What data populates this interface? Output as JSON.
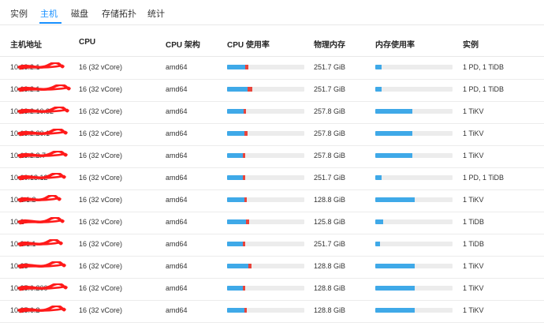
{
  "tabs": [
    {
      "label": "实例",
      "active": false
    },
    {
      "label": "主机",
      "active": true
    },
    {
      "label": "磁盘",
      "active": false
    },
    {
      "label": "存储拓扑",
      "active": false
    },
    {
      "label": "统计",
      "active": false
    }
  ],
  "columns": [
    "主机地址",
    "CPU",
    "CPU 架构",
    "CPU 使用率",
    "物理内存",
    "内存使用率",
    "实例"
  ],
  "colors": {
    "accent": "#1890ff",
    "cpu_user": "#3fa9e8",
    "cpu_sys": "#e8453c",
    "mem_used": "#3fa9e8",
    "redaction": "#ff1a1a",
    "track": "#ececec"
  },
  "rows": [
    {
      "host": "10.13.2.1",
      "cpu": "16 (32 vCore)",
      "arch": "amd64",
      "cpu_user": 0.23,
      "cpu_sys": 0.04,
      "memory": "251.7 GiB",
      "mem_usage": 0.08,
      "instances": "1 PD, 1 TiDB"
    },
    {
      "host": "10.13.2.1",
      "cpu": "16 (32 vCore)",
      "arch": "amd64",
      "cpu_user": 0.27,
      "cpu_sys": 0.06,
      "memory": "251.7 GiB",
      "mem_usage": 0.08,
      "instances": "1 PD, 1 TiDB"
    },
    {
      "host": "10.13.2.10.32",
      "cpu": "16 (32 vCore)",
      "arch": "amd64",
      "cpu_user": 0.21,
      "cpu_sys": 0.03,
      "memory": "257.8 GiB",
      "mem_usage": 0.48,
      "instances": "1 TiKV"
    },
    {
      "host": "10.13.2.20.1",
      "cpu": "16 (32 vCore)",
      "arch": "amd64",
      "cpu_user": 0.22,
      "cpu_sys": 0.04,
      "memory": "257.8 GiB",
      "mem_usage": 0.48,
      "instances": "1 TiKV"
    },
    {
      "host": "10.13.2.2.7",
      "cpu": "16 (32 vCore)",
      "arch": "amd64",
      "cpu_user": 0.2,
      "cpu_sys": 0.03,
      "memory": "257.8 GiB",
      "mem_usage": 0.48,
      "instances": "1 TiKV"
    },
    {
      "host": "10.10.13.12",
      "cpu": "16 (32 vCore)",
      "arch": "amd64",
      "cpu_user": 0.2,
      "cpu_sys": 0.03,
      "memory": "251.7 GiB",
      "mem_usage": 0.08,
      "instances": "1 PD, 1 TiDB"
    },
    {
      "host": "10.1.1.2",
      "cpu": "16 (32 vCore)",
      "arch": "amd64",
      "cpu_user": 0.22,
      "cpu_sys": 0.03,
      "memory": "128.8 GiB",
      "mem_usage": 0.51,
      "instances": "1 TiKV"
    },
    {
      "host": "10.1",
      "cpu": "16 (32 vCore)",
      "arch": "amd64",
      "cpu_user": 0.24,
      "cpu_sys": 0.04,
      "memory": "125.8 GiB",
      "mem_usage": 0.1,
      "instances": "1 TiDB"
    },
    {
      "host": "10.2.1.1",
      "cpu": "16 (32 vCore)",
      "arch": "amd64",
      "cpu_user": 0.2,
      "cpu_sys": 0.03,
      "memory": "251.7 GiB",
      "mem_usage": 0.06,
      "instances": "1 TiDB"
    },
    {
      "host": "10.25",
      "cpu": "16 (32 vCore)",
      "arch": "amd64",
      "cpu_user": 0.28,
      "cpu_sys": 0.04,
      "memory": "128.8 GiB",
      "mem_usage": 0.51,
      "instances": "1 TiKV"
    },
    {
      "host": "10.25.0.200",
      "cpu": "16 (32 vCore)",
      "arch": "amd64",
      "cpu_user": 0.2,
      "cpu_sys": 0.03,
      "memory": "128.8 GiB",
      "mem_usage": 0.51,
      "instances": "1 TiKV"
    },
    {
      "host": "10.25.6.2",
      "cpu": "16 (32 vCore)",
      "arch": "amd64",
      "cpu_user": 0.22,
      "cpu_sys": 0.03,
      "memory": "128.8 GiB",
      "mem_usage": 0.51,
      "instances": "1 TiKV"
    }
  ]
}
